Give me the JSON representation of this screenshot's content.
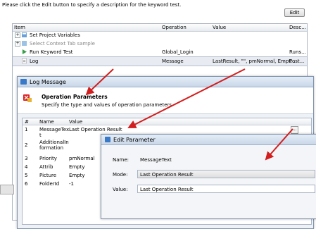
{
  "hint_text": "Please click the Edit button to specify a description for the keyword test.",
  "edit_button": "Edit",
  "grid": {
    "columns": [
      "Item",
      "Operation",
      "Value",
      "Desc..."
    ],
    "rows": [
      {
        "item": "Set Project Variables",
        "operation": "",
        "value": "",
        "desc": ""
      },
      {
        "item": "Select Context Tab sample",
        "operation": "",
        "value": "",
        "desc": ""
      },
      {
        "item": "Run Keyword Test",
        "operation": "Global_Login",
        "value": "",
        "desc": "Runs..."
      },
      {
        "item": "Log",
        "operation": "Message",
        "value": "LastResult, \"\", pmNormal, Empt...",
        "desc": "Post..."
      }
    ]
  },
  "log_dialog": {
    "title": "Log Message",
    "header_title": "Operation Parameters",
    "header_subtitle": "Specify the type and values of operation parameters",
    "columns": [
      "#",
      "Name",
      "Value"
    ],
    "params": [
      {
        "num": "1",
        "name": "MessageTex\nt",
        "value": "Last Operation Result"
      },
      {
        "num": "2",
        "name": "AdditionalIn\nformation",
        "value": ""
      },
      {
        "num": "3",
        "name": "Priority",
        "value": "pmNormal"
      },
      {
        "num": "4",
        "name": "Attrib",
        "value": "Empty"
      },
      {
        "num": "5",
        "name": "Picture",
        "value": "Empty"
      },
      {
        "num": "6",
        "name": "FolderId",
        "value": "-1"
      }
    ],
    "ellipsis": "..."
  },
  "edit_dialog": {
    "title": "Edit Parameter",
    "name_label": "Name:",
    "name_value": "MessageText",
    "mode_label": "Mode:",
    "mode_value": "Last Operation Result",
    "value_label": "Value:",
    "value_value": "Last Operation Result"
  },
  "colors": {
    "arrow": "#d21e1e",
    "dialog_title": "#c9d7e8",
    "selection": "#e8ecf2"
  }
}
